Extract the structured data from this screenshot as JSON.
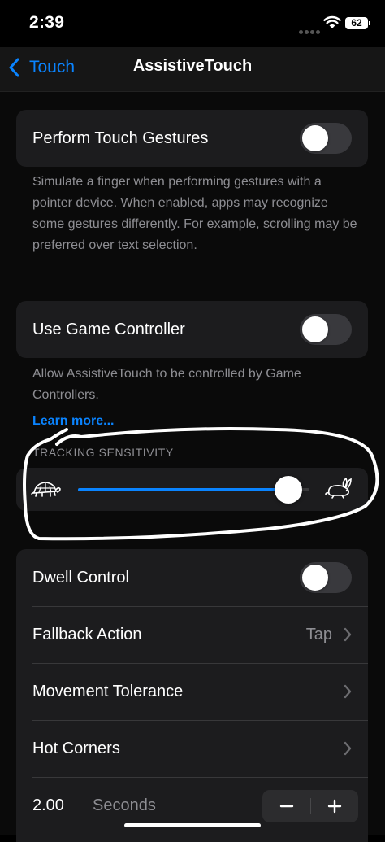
{
  "status_bar": {
    "time": "2:39",
    "battery": "62"
  },
  "nav": {
    "back_label": "Touch",
    "title": "AssistiveTouch"
  },
  "touch_gestures": {
    "label": "Perform Touch Gestures",
    "enabled": false,
    "footnote": "Simulate a finger when performing gestures with a pointer device. When enabled, apps may recognize some gestures differently. For example, scrolling may be preferred over text selection."
  },
  "game_controller": {
    "label": "Use Game Controller",
    "enabled": false,
    "footnote": "Allow AssistiveTouch to be controlled by Game Controllers.",
    "link": "Learn more..."
  },
  "tracking_sensitivity": {
    "header": "TRACKING SENSITIVITY",
    "value": 0.91,
    "min_icon": "turtle-icon",
    "max_icon": "rabbit-icon"
  },
  "dwell": {
    "label": "Dwell Control",
    "enabled": false,
    "fallback_label": "Fallback Action",
    "fallback_value": "Tap",
    "movement_label": "Movement Tolerance",
    "hot_corners_label": "Hot Corners",
    "seconds_value": "2.00",
    "seconds_unit": "Seconds",
    "minus": "−",
    "plus": "+"
  },
  "colors": {
    "accent": "#0a84ff",
    "annotation": "#ffffff",
    "cell_background": "#1c1c1e"
  }
}
